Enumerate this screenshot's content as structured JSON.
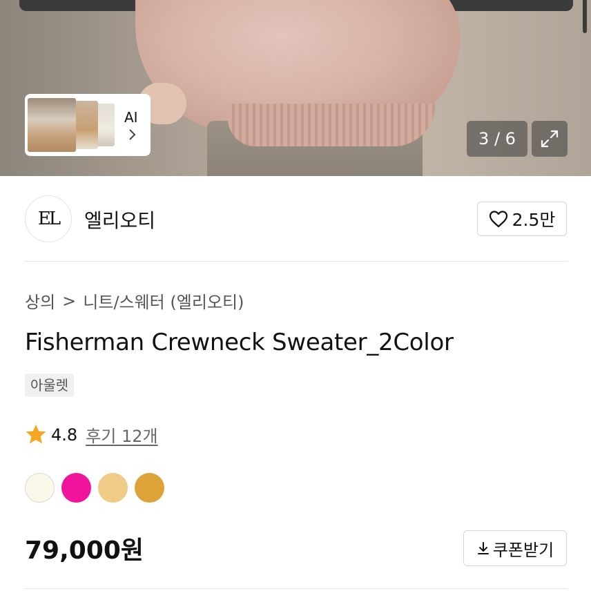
{
  "gallery": {
    "ai_label": "AI",
    "counter": "3 / 6",
    "icons": {
      "expand": "expand-arrows-icon",
      "chevron": "chevron-right-icon"
    }
  },
  "brand": {
    "logo_text": "EL",
    "name": "엘리오티",
    "like_count": "2.5만",
    "like_icon": "heart-outline-icon"
  },
  "breadcrumb": {
    "category": "상의",
    "subcategory": "니트/스웨터 (엘리오티)",
    "separator": ">"
  },
  "product": {
    "title": "Fisherman Crewneck Sweater_2Color",
    "tag": "아울렛",
    "rating": "4.8",
    "review_link": "후기 12개",
    "rating_color": "#f5a623",
    "swatches": [
      {
        "color": "#fbf8ea",
        "border": "#d8d8d8"
      },
      {
        "color": "#f0139c"
      },
      {
        "color": "#eecb86"
      },
      {
        "color": "#dda238"
      }
    ],
    "price": "79,000원",
    "coupon_label": "쿠폰받기",
    "coupon_icon": "download-arrow-icon"
  }
}
